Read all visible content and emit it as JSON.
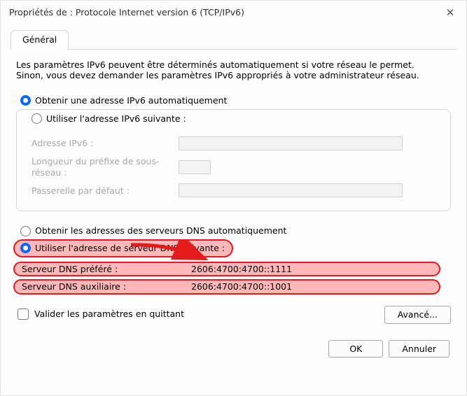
{
  "window": {
    "title": "Propriétés de : Protocole Internet version 6 (TCP/IPv6)",
    "close_glyph": "✕"
  },
  "tab": {
    "label": "Général"
  },
  "intro": "Les paramètres IPv6 peuvent être déterminés automatiquement si votre réseau le permet. Sinon, vous devez demander les paramètres IPv6 appropriés à votre administrateur réseau.",
  "ip_mode": {
    "auto": {
      "label": "Obtenir une adresse IPv6 automatiquement",
      "selected": true
    },
    "manual": {
      "label": "Utiliser l'adresse IPv6 suivante :",
      "selected": false
    }
  },
  "ip_fields": {
    "address": {
      "label": "Adresse IPv6 :",
      "value": ""
    },
    "prefix": {
      "label": "Longueur du préfixe de sous-réseau :",
      "value": ""
    },
    "gateway": {
      "label": "Passerelle par défaut :",
      "value": ""
    }
  },
  "dns_mode": {
    "auto": {
      "label": "Obtenir les adresses des serveurs DNS automatiquement",
      "selected": false
    },
    "manual": {
      "label": "Utiliser l'adresse de serveur DNS suivante :",
      "selected": true
    }
  },
  "dns_fields": {
    "preferred": {
      "label": "Serveur DNS préféré :",
      "value": "2606:4700:4700::1111"
    },
    "alternate": {
      "label": "Serveur DNS auxiliaire :",
      "value": "2606:4700:4700::1001"
    }
  },
  "validate_on_exit": {
    "label": "Valider les paramètres en quittant",
    "checked": false
  },
  "buttons": {
    "advanced": "Avancé...",
    "ok": "OK",
    "cancel": "Annuler"
  },
  "colors": {
    "highlight_border": "#e51b1b",
    "highlight_fill": "#ffb8b8",
    "accent": "#0a66ff"
  }
}
